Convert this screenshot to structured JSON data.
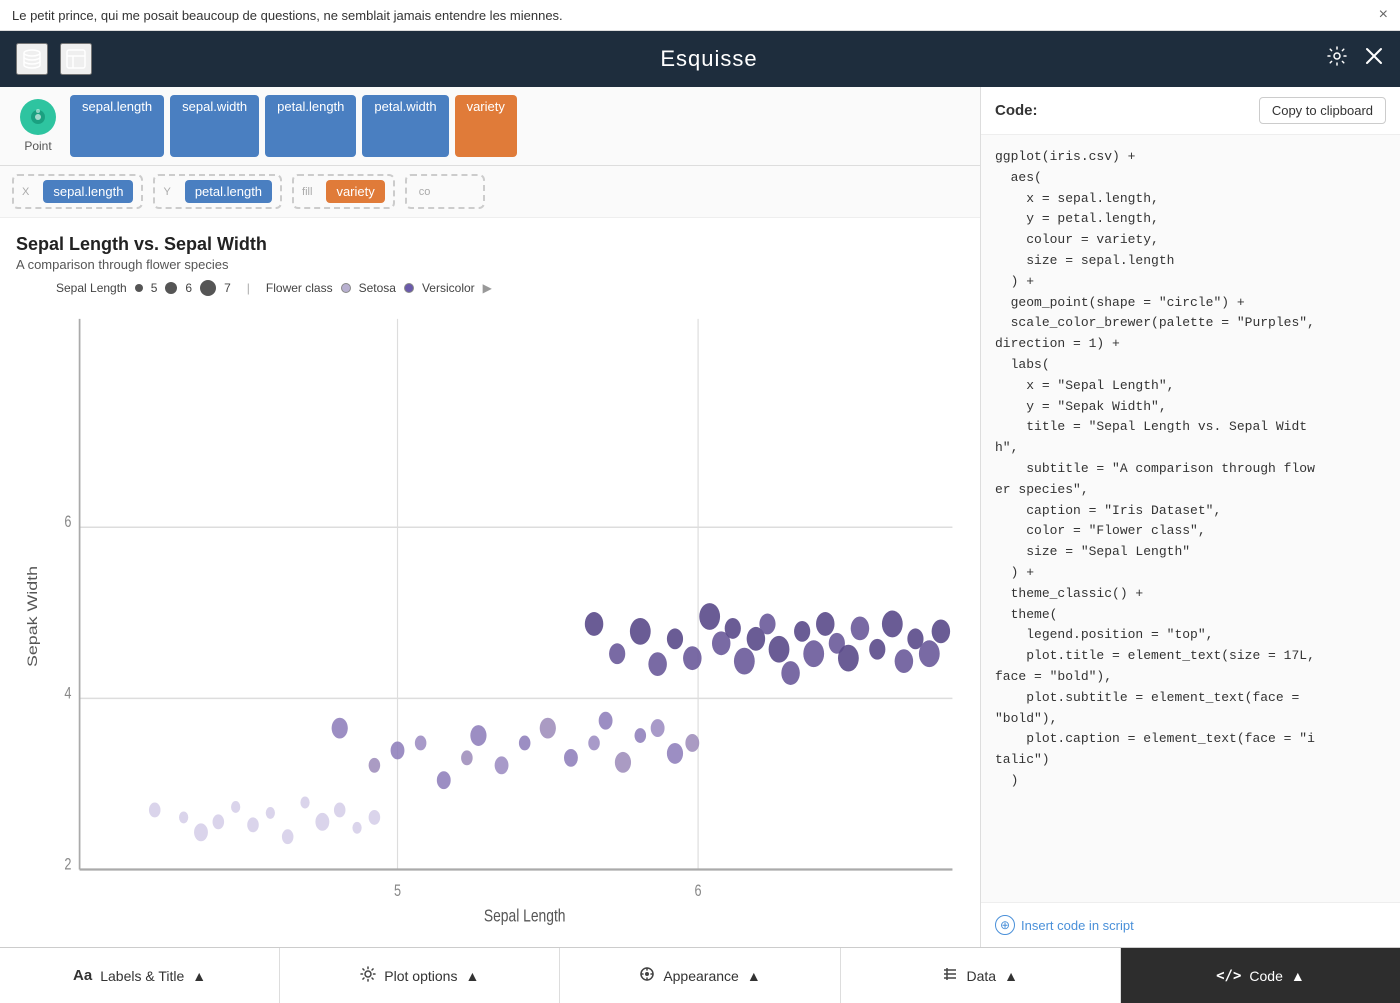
{
  "notification": {
    "text": "Le petit prince, qui me posait beaucoup de questions, ne semblait jamais entendre les miennes.",
    "close_label": "×"
  },
  "header": {
    "title": "Esquisse",
    "db_icon": "database",
    "table_icon": "table",
    "settings_icon": "⚙",
    "close_icon": "×"
  },
  "fields": [
    {
      "label": "sepal.length",
      "color": "blue"
    },
    {
      "label": "sepal.width",
      "color": "blue"
    },
    {
      "label": "petal.length",
      "color": "blue"
    },
    {
      "label": "petal.width",
      "color": "blue"
    },
    {
      "label": "variety",
      "color": "orange"
    }
  ],
  "axes": [
    {
      "slot_label": "X",
      "field": "sepal.length",
      "color": "blue"
    },
    {
      "slot_label": "Y",
      "field": "petal.length",
      "color": "blue"
    },
    {
      "slot_label": "fill",
      "field": "variety",
      "color": "orange"
    },
    {
      "slot_label": "co",
      "field": "",
      "color": "blue"
    }
  ],
  "plot": {
    "title": "Sepal Length vs. Sepal Width",
    "subtitle": "A comparison through flower species",
    "x_label": "Sepal Length",
    "y_label": "Sepak Width",
    "legend_size_label": "Sepal Length",
    "legend_color_label": "Flower class",
    "legend_size_values": [
      "5",
      "6",
      "7"
    ],
    "legend_color_values": [
      "Setosa",
      "Versicolor"
    ]
  },
  "code": {
    "label": "Code:",
    "content": "ggplot(iris.csv) +\n  aes(\n    x = sepal.length,\n    y = petal.length,\n    colour = variety,\n    size = sepal.length\n  ) +\n  geom_point(shape = \"circle\") +\n  scale_color_brewer(palette = \"Purples\",\ndirection = 1) +\n  labs(\n    x = \"Sepal Length\",\n    y = \"Sepak Width\",\n    title = \"Sepal Length vs. Sepal Widt\nh\",\n    subtitle = \"A comparison through flow\ner species\",\n    caption = \"Iris Dataset\",\n    color = \"Flower class\",\n    size = \"Sepal Length\"\n  ) +\n  theme_classic() +\n  theme(\n    legend.position = \"top\",\n    plot.title = element_text(size = 17L,\nface = \"bold\"),\n    plot.subtitle = element_text(face =\n\"bold\"),\n    plot.caption = element_text(face = \"i\ntalic\")\n  )",
    "copy_label": "Copy to clipboard",
    "insert_label": "Insert code in script"
  },
  "toolbar": [
    {
      "id": "labels",
      "icon": "Aa",
      "label": "Labels & Title",
      "arrow": "▲",
      "active": false
    },
    {
      "id": "plot-options",
      "icon": "⚙",
      "label": "Plot options",
      "arrow": "▲",
      "active": false
    },
    {
      "id": "appearance",
      "icon": "☺",
      "label": "Appearance",
      "arrow": "▲",
      "active": false
    },
    {
      "id": "data",
      "icon": "≡",
      "label": "Data",
      "arrow": "▲",
      "active": false
    },
    {
      "id": "code",
      "icon": "</>",
      "label": "Code",
      "arrow": "▲",
      "active": true
    }
  ],
  "geom": {
    "label": "Point",
    "color": "#2ec4a0"
  }
}
